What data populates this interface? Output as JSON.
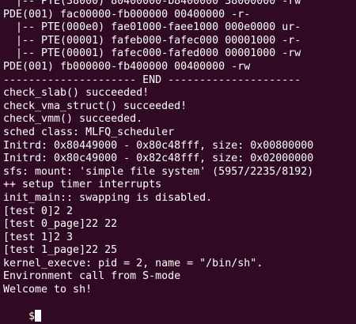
{
  "terminal": {
    "lines": [
      "  |-- PTE(38000) 80400000-b8400000 38000000 -rw",
      "PDE(001) fac00000-fb000000 00400000 -r-",
      "  |-- PTE(000e0) fae01000-faee1000 000e0000 ur-",
      "  |-- PTE(00001) fafeb000-fafec000 00001000 -r-",
      "  |-- PTE(00001) fafec000-fafed000 00001000 -rw",
      "PDE(001) fb000000-fb400000 00400000 -rw",
      "--------------------- END ---------------------",
      "check_slab() succeeded!",
      "check_vma_struct() succeeded!",
      "check_vmm() succeeded.",
      "sched class: MLFQ_scheduler",
      "Initrd: 0x80449000 - 0x80c48fff, size: 0x00800000",
      "Initrd: 0x80c49000 - 0x82c48fff, size: 0x02000000",
      "sfs: mount: 'simple file system' (5957/2235/8192)",
      "++ setup timer interrupts",
      "init_main:: swapping is disabled.",
      "[test 0]2 2",
      "[test 0_page]22 22",
      "[test 1]2 3",
      "[test 1_page]22 25",
      "kernel_execve: pid = 2, name = \"/bin/sh\".",
      "Environment call from S-mode",
      "Welcome to sh!"
    ],
    "prompt": "$"
  },
  "colors": {
    "background": "#300a24",
    "text": "#ffffff"
  }
}
